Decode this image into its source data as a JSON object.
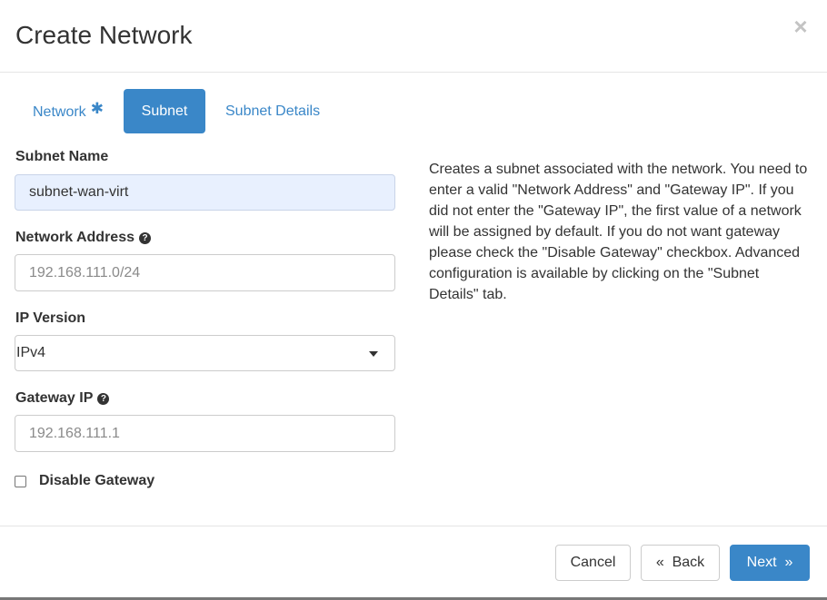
{
  "dialog": {
    "title": "Create Network",
    "close_icon": "×"
  },
  "tabs": [
    {
      "label": "Network",
      "required_marker": "✱",
      "active": false
    },
    {
      "label": "Subnet",
      "active": true
    },
    {
      "label": "Subnet Details",
      "active": false
    }
  ],
  "form": {
    "subnet_name": {
      "label": "Subnet Name",
      "value": "subnet-wan-virt"
    },
    "network_address": {
      "label": "Network Address",
      "help_icon": "question-circle-icon",
      "placeholder": "192.168.111.0/24",
      "value": ""
    },
    "ip_version": {
      "label": "IP Version",
      "selected": "IPv4"
    },
    "gateway_ip": {
      "label": "Gateway IP",
      "help_icon": "question-circle-icon",
      "placeholder": "192.168.111.1",
      "value": ""
    },
    "disable_gateway": {
      "label": "Disable Gateway",
      "checked": false
    }
  },
  "description": "Creates a subnet associated with the network. You need to enter a valid \"Network Address\" and \"Gateway IP\". If you did not enter the \"Gateway IP\", the first value of a network will be assigned by default. If you do not want gateway please check the \"Disable Gateway\" checkbox. Advanced configuration is available by clicking on the \"Subnet Details\" tab.",
  "footer": {
    "cancel_label": "Cancel",
    "back_label": "«  Back",
    "next_label": "Next  »"
  },
  "colors": {
    "primary": "#3a87c8",
    "autofill_bg": "#e8f0fe"
  }
}
